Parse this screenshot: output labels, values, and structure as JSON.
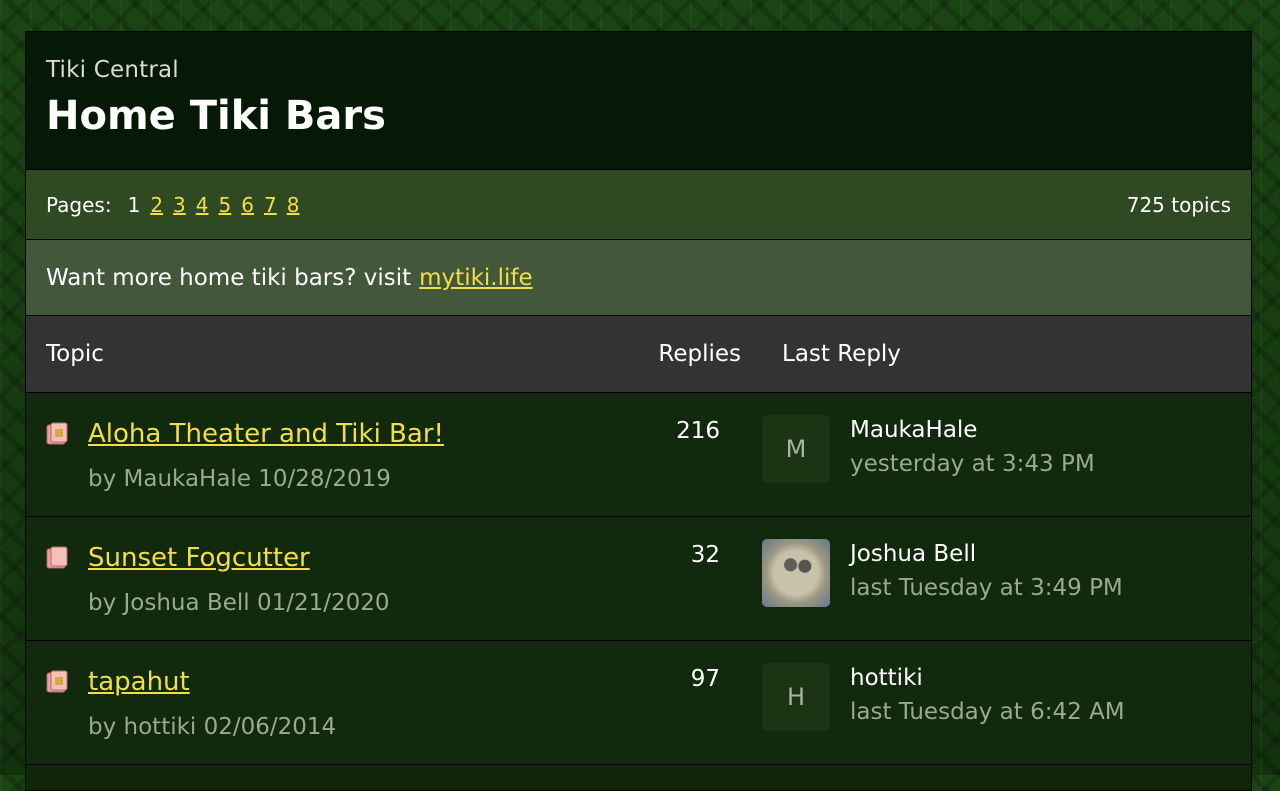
{
  "header": {
    "site_name": "Tiki Central",
    "forum_title": "Home Tiki Bars"
  },
  "pagination": {
    "label": "Pages:",
    "current": "1",
    "pages": [
      "2",
      "3",
      "4",
      "5",
      "6",
      "7",
      "8"
    ],
    "topic_count": "725 topics"
  },
  "promo": {
    "text": "Want more home tiki bars? visit",
    "link": "mytiki.life"
  },
  "table": {
    "columns": {
      "topic": "Topic",
      "replies": "Replies",
      "last_reply": "Last Reply"
    },
    "rows": [
      {
        "title": "Aloha Theater and Tiki Bar!",
        "meta": "by MaukaHale 10/28/2019",
        "replies": "216",
        "avatar_initial": "M",
        "last_user": "MaukaHale",
        "last_time": "yesterday at 3:43 PM"
      },
      {
        "title": "Sunset Fogcutter",
        "meta": "by Joshua Bell 01/21/2020",
        "replies": "32",
        "avatar_initial": "",
        "last_user": "Joshua Bell",
        "last_time": "last Tuesday at 3:49 PM"
      },
      {
        "title": "tapahut",
        "meta": "by hottiki 02/06/2014",
        "replies": "97",
        "avatar_initial": "H",
        "last_user": "hottiki",
        "last_time": "last Tuesday at 6:42 AM"
      }
    ]
  },
  "icons": {
    "topic_icon": "folder-icon"
  },
  "colors": {
    "link": "#f4de46",
    "header_bg": "#061806",
    "pages_bar_bg": "#2f4a22",
    "promo_bg": "#43573a",
    "table_head_bg": "#333333",
    "row_bg": "#11290c"
  }
}
